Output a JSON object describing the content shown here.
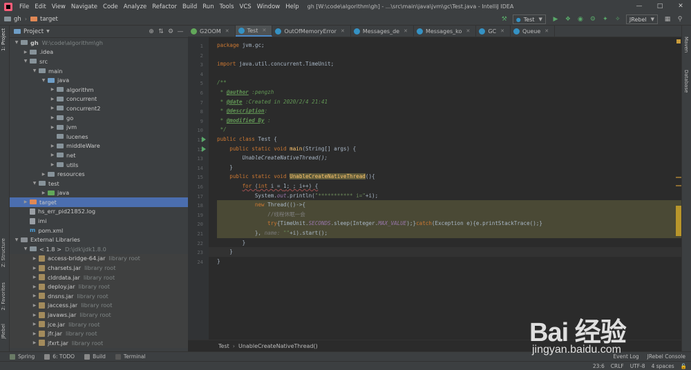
{
  "titlebar": {
    "menus": [
      "File",
      "Edit",
      "View",
      "Navigate",
      "Code",
      "Analyze",
      "Refactor",
      "Build",
      "Run",
      "Tools",
      "VCS",
      "Window",
      "Help"
    ],
    "title": "gh [W:\\code\\algorithm\\gh] - ...\\src\\main\\java\\jvm\\gc\\Test.java - IntelliJ IDEA"
  },
  "navbar": {
    "project": "gh",
    "folder": "target",
    "run_config": "Test",
    "jrebel": "JRebel"
  },
  "side_tabs": {
    "left": [
      "1: Project",
      "Z: Structure",
      "2: Favorites",
      "JRebel"
    ],
    "right": [
      "Maven",
      "Database"
    ]
  },
  "project_panel": {
    "title": "Project",
    "tree": [
      {
        "label": "gh",
        "extra": "W:\\code\\algorithm\\gh",
        "indent": 0,
        "kind": "folder",
        "open": true
      },
      {
        "label": ".idea",
        "indent": 1,
        "kind": "folder",
        "open": false
      },
      {
        "label": "src",
        "indent": 1,
        "kind": "folder",
        "open": true
      },
      {
        "label": "main",
        "indent": 2,
        "kind": "folder",
        "open": true
      },
      {
        "label": "java",
        "indent": 3,
        "kind": "folder-blue",
        "open": true
      },
      {
        "label": "algorithm",
        "indent": 4,
        "kind": "folder",
        "open": false
      },
      {
        "label": "concurrent",
        "indent": 4,
        "kind": "folder",
        "open": false
      },
      {
        "label": "concurrent2",
        "indent": 4,
        "kind": "folder",
        "open": false
      },
      {
        "label": "go",
        "indent": 4,
        "kind": "folder",
        "open": false
      },
      {
        "label": "jvm",
        "indent": 4,
        "kind": "folder",
        "open": false
      },
      {
        "label": "lucenes",
        "indent": 4,
        "kind": "folder",
        "leaf": true
      },
      {
        "label": "middleWare",
        "indent": 4,
        "kind": "folder",
        "open": false
      },
      {
        "label": "net",
        "indent": 4,
        "kind": "folder",
        "open": false
      },
      {
        "label": "utils",
        "indent": 4,
        "kind": "folder",
        "open": false
      },
      {
        "label": "resources",
        "indent": 3,
        "kind": "folder",
        "open": false
      },
      {
        "label": "test",
        "indent": 2,
        "kind": "folder",
        "open": true
      },
      {
        "label": "java",
        "indent": 3,
        "kind": "folder-green",
        "open": false
      },
      {
        "label": "target",
        "indent": 1,
        "kind": "folder-orange",
        "open": false,
        "selected": true
      },
      {
        "label": "hs_err_pid21852.log",
        "indent": 1,
        "kind": "file",
        "leaf": true
      },
      {
        "label": "imi",
        "indent": 1,
        "kind": "file",
        "leaf": true
      },
      {
        "label": "pom.xml",
        "indent": 1,
        "kind": "maven",
        "leaf": true
      },
      {
        "label": "External Libraries",
        "indent": 0,
        "kind": "lib",
        "open": true
      },
      {
        "label": "< 1.8 >",
        "extra": "D:\\jdk\\jdk1.8.0",
        "indent": 1,
        "kind": "folder",
        "open": true
      },
      {
        "label": "access-bridge-64.jar",
        "extra": "library root",
        "indent": 2,
        "kind": "jar",
        "lib": true
      },
      {
        "label": "charsets.jar",
        "extra": "library root",
        "indent": 2,
        "kind": "jar",
        "lib": true
      },
      {
        "label": "cldrdata.jar",
        "extra": "library root",
        "indent": 2,
        "kind": "jar",
        "lib": true
      },
      {
        "label": "deploy.jar",
        "extra": "library root",
        "indent": 2,
        "kind": "jar",
        "lib": true
      },
      {
        "label": "dnsns.jar",
        "extra": "library root",
        "indent": 2,
        "kind": "jar",
        "lib": true
      },
      {
        "label": "jaccess.jar",
        "extra": "library root",
        "indent": 2,
        "kind": "jar",
        "lib": true
      },
      {
        "label": "javaws.jar",
        "extra": "library root",
        "indent": 2,
        "kind": "jar",
        "lib": true
      },
      {
        "label": "jce.jar",
        "extra": "library root",
        "indent": 2,
        "kind": "jar",
        "lib": true
      },
      {
        "label": "jfr.jar",
        "extra": "library root",
        "indent": 2,
        "kind": "jar",
        "lib": true
      },
      {
        "label": "jfxrt.jar",
        "extra": "library root",
        "indent": 2,
        "kind": "jar",
        "lib": true
      }
    ]
  },
  "editor": {
    "tabs": [
      {
        "label": "G2OOM",
        "icon": "g"
      },
      {
        "label": "Test",
        "active": true
      },
      {
        "label": "OutOfMemoryError"
      },
      {
        "label": "Messages_de"
      },
      {
        "label": "Messages_ko"
      },
      {
        "label": "GC"
      },
      {
        "label": "Queue"
      }
    ],
    "line_numbers": [
      "1",
      "2",
      "3",
      "4",
      "5",
      "6",
      "7",
      "8",
      "9",
      "10",
      "11",
      "12",
      "13",
      "14",
      "15",
      "16",
      "17",
      "18",
      "19",
      "20",
      "21",
      "22",
      "23",
      "24"
    ],
    "breadcrumb": [
      "Test",
      "UnableCreateNativeThread()"
    ]
  },
  "code": {
    "l1": [
      "package",
      " jvm.gc;"
    ],
    "l3": [
      "import",
      " java.util.concurrent.TimeUnit;"
    ],
    "l5": "/**",
    "l6": [
      " * ",
      "@author",
      " :pengzh"
    ],
    "l7": [
      " * ",
      "@date",
      " :Created in 2020/2/4 21:41"
    ],
    "l8": [
      " * ",
      "@description",
      ":"
    ],
    "l9": [
      " * ",
      "@modified By",
      " :"
    ],
    "l10": " */",
    "l11": [
      "public class",
      " Test {"
    ],
    "l12": [
      "    public static void ",
      "main",
      "(String[] args) {"
    ],
    "l13": "        UnableCreateNativeThread();",
    "l14": "    }",
    "l15": [
      "    public static void ",
      "UnableCreateNativeThread",
      "(){"
    ],
    "l16": [
      "        ",
      "for",
      " (",
      "int",
      " i = ",
      "1",
      "; ; i++) {"
    ],
    "l17": [
      "            System.",
      "out",
      ".println(",
      "\"*********** i=\"",
      "+i);"
    ],
    "l18": [
      "            ",
      "new",
      " Thread(()->{"
    ],
    "l19": [
      "                ",
      "//线程休眠一会"
    ],
    "l20": [
      "                ",
      "try",
      "{TimeUnit.",
      "SECONDS",
      ".sleep(Integer.",
      "MAX_VALUE",
      ");}",
      "catch",
      "(Exception e){e.printStackTrace();}"
    ],
    "l21": [
      "            }, ",
      "name:",
      " ",
      "\"\"",
      "+i).start();"
    ],
    "l22": "        }",
    "l23": "    }",
    "l24": "}"
  },
  "bottom_tools": {
    "left": [
      "Spring",
      "6: TODO",
      "Build",
      "Terminal"
    ],
    "right": [
      "Event Log",
      "JRebel Console"
    ]
  },
  "status": {
    "position": "23:6",
    "line_sep": "CRLF",
    "encoding": "UTF-8",
    "indent": "4 spaces"
  },
  "watermark": {
    "logo": "Bai 经验",
    "url": "jingyan.baidu.com"
  }
}
